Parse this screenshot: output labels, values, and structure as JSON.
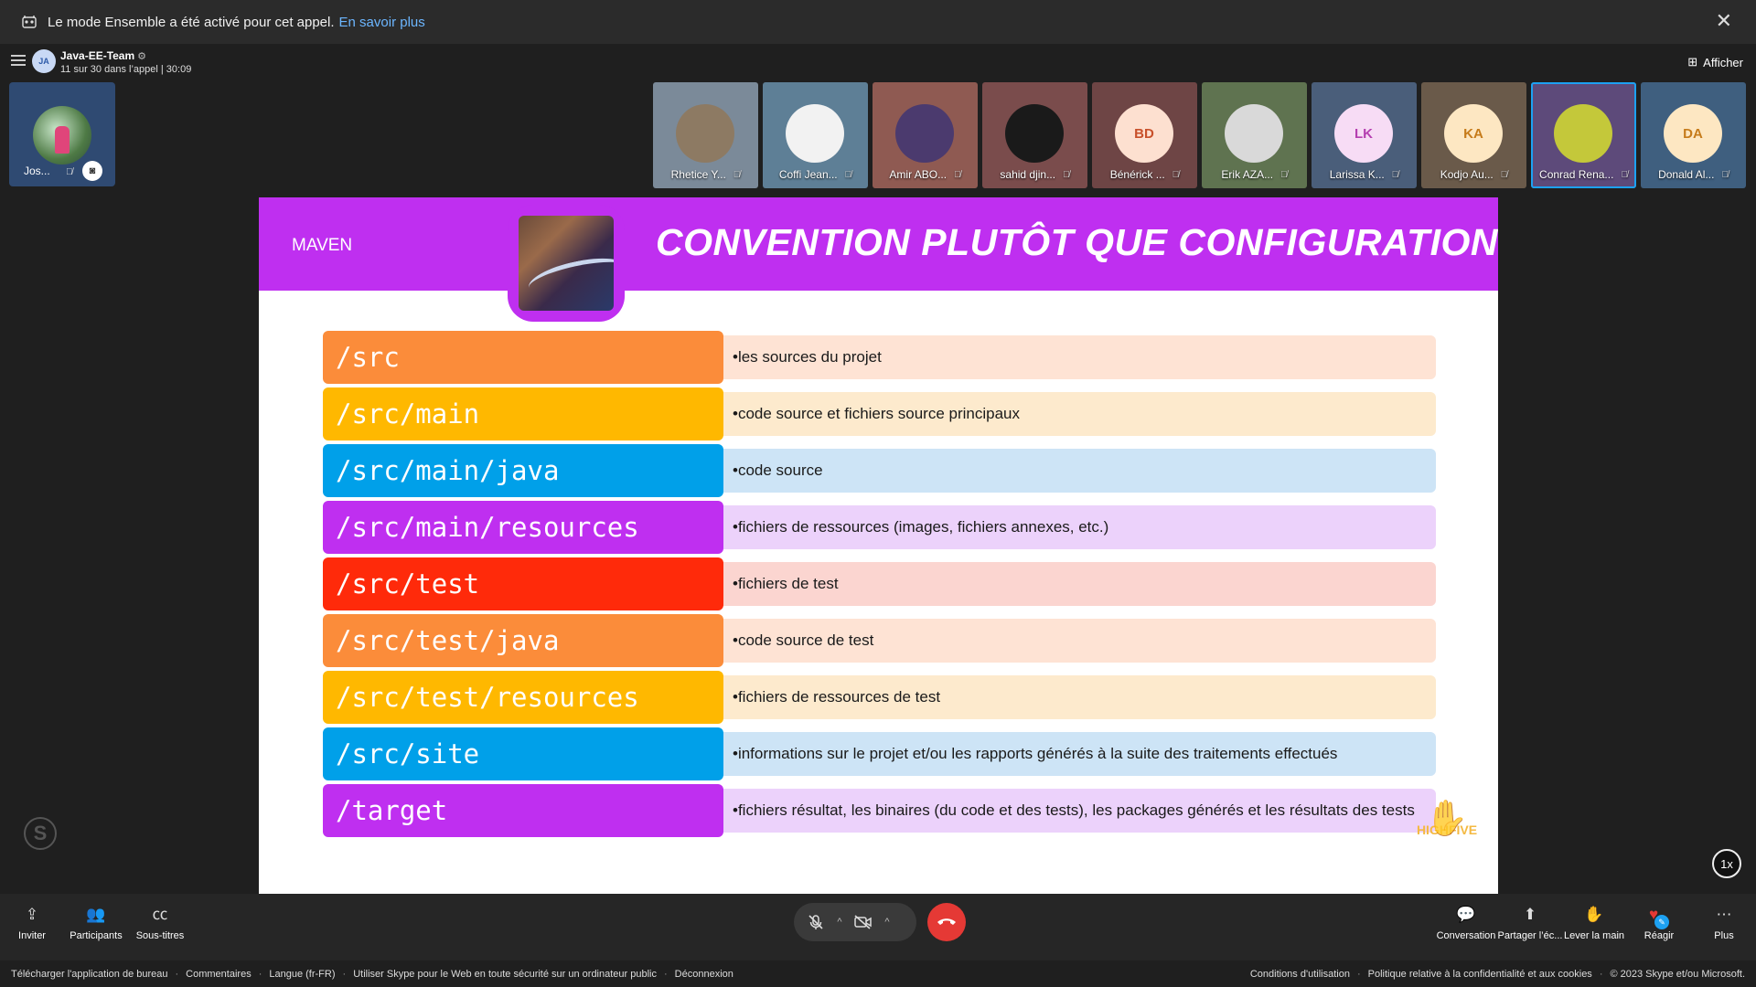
{
  "notification": {
    "message": "Le mode Ensemble a été activé pour cet appel.",
    "link": "En savoir plus"
  },
  "header": {
    "group_initials": "JA",
    "group_name": "Java-EE-Team",
    "call_info": "11 sur 30 dans l’appel | 30:09",
    "view_button": "Afficher"
  },
  "self_tile": {
    "name": "Jos..."
  },
  "participants": [
    {
      "name": "Rhetice Y...",
      "initials": "",
      "bg": "#7b8a99",
      "avatar_bg": "#8d7a63",
      "fg": "#ffffff"
    },
    {
      "name": "Coffi Jean...",
      "initials": "",
      "bg": "#5e7f96",
      "avatar_bg": "#f2f2f2",
      "fg": "#333333"
    },
    {
      "name": "Amir ABO...",
      "initials": "",
      "bg": "#8f5a52",
      "avatar_bg": "#4b3a6e",
      "fg": "#ffffff"
    },
    {
      "name": "sahid djin...",
      "initials": "",
      "bg": "#7a4c4c",
      "avatar_bg": "#1a1a1a",
      "fg": "#ffffff"
    },
    {
      "name": "Bénérick ...",
      "initials": "BD",
      "bg": "#6e4545",
      "avatar_bg": "#fde0d0",
      "fg": "#c8502a"
    },
    {
      "name": "Erik AZA...",
      "initials": "",
      "bg": "#5f7350",
      "avatar_bg": "#d9d9d9",
      "fg": "#333333"
    },
    {
      "name": "Larissa K...",
      "initials": "LK",
      "bg": "#4a5e7a",
      "avatar_bg": "#f7dcf5",
      "fg": "#b53fb0"
    },
    {
      "name": "Kodjo Au...",
      "initials": "KA",
      "bg": "#6a5a4a",
      "avatar_bg": "#fde7c2",
      "fg": "#c67b1a"
    },
    {
      "name": "Conrad Rena...",
      "initials": "",
      "bg": "#5d4a7a",
      "avatar_bg": "#c4c83a",
      "fg": "#ffffff"
    },
    {
      "name": "Donald Al...",
      "initials": "DA",
      "bg": "#3f5f7f",
      "avatar_bg": "#fde7c2",
      "fg": "#c67b1a"
    }
  ],
  "slide": {
    "tag": "MAVEN",
    "title": "CONVENTION PLUTÔT QUE CONFIGURATION",
    "rows": [
      {
        "path": "/src",
        "desc": "•les sources du projet",
        "color": "#fb8c3a",
        "light": "#fee3d4"
      },
      {
        "path": "/src/main",
        "desc": "•code source et fichiers source principaux",
        "color": "#ffb800",
        "light": "#fdeacd"
      },
      {
        "path": "/src/main/java",
        "desc": "•code source",
        "color": "#00a0e9",
        "light": "#cde4f6"
      },
      {
        "path": "/src/main/resources",
        "desc": "•fichiers de ressources (images, fichiers annexes, etc.)",
        "color": "#bf2ff0",
        "light": "#ecd2fb"
      },
      {
        "path": "/src/test",
        "desc": "•fichiers de test",
        "color": "#ff2a0a",
        "light": "#fbd5d0"
      },
      {
        "path": "/src/test/java",
        "desc": "•code source de test",
        "color": "#fb8c3a",
        "light": "#fee3d4"
      },
      {
        "path": "/src/test/resources",
        "desc": "•fichiers de ressources de test",
        "color": "#ffb800",
        "light": "#fdeacd"
      },
      {
        "path": "/src/site",
        "desc": "•informations sur le projet et/ou les rapports générés à la suite des traitements effectués",
        "color": "#00a0e9",
        "light": "#cde4f6"
      },
      {
        "path": "/target",
        "desc": "•fichiers résultat, les binaires (du code et des tests), les packages générés et les résultats des tests",
        "color": "#bf2ff0",
        "light": "#ecd2fb"
      }
    ],
    "logo_text": "HIGHFIVE"
  },
  "speed": "1x",
  "controls": {
    "invite": "Inviter",
    "participants": "Participants",
    "subtitles": "Sous-titres",
    "conversation": "Conversation",
    "share": "Partager l’éc...",
    "raise_hand": "Lever la main",
    "react": "Réagir",
    "more": "Plus"
  },
  "footer": {
    "left": [
      "Télécharger l'application de bureau",
      "Commentaires",
      "Langue (fr-FR)",
      "Utiliser Skype pour le Web en toute sécurité sur un ordinateur public",
      "Déconnexion"
    ],
    "right": [
      "Conditions d'utilisation",
      "Politique relative à la confidentialité et aux cookies",
      "© 2023 Skype et/ou Microsoft."
    ]
  }
}
